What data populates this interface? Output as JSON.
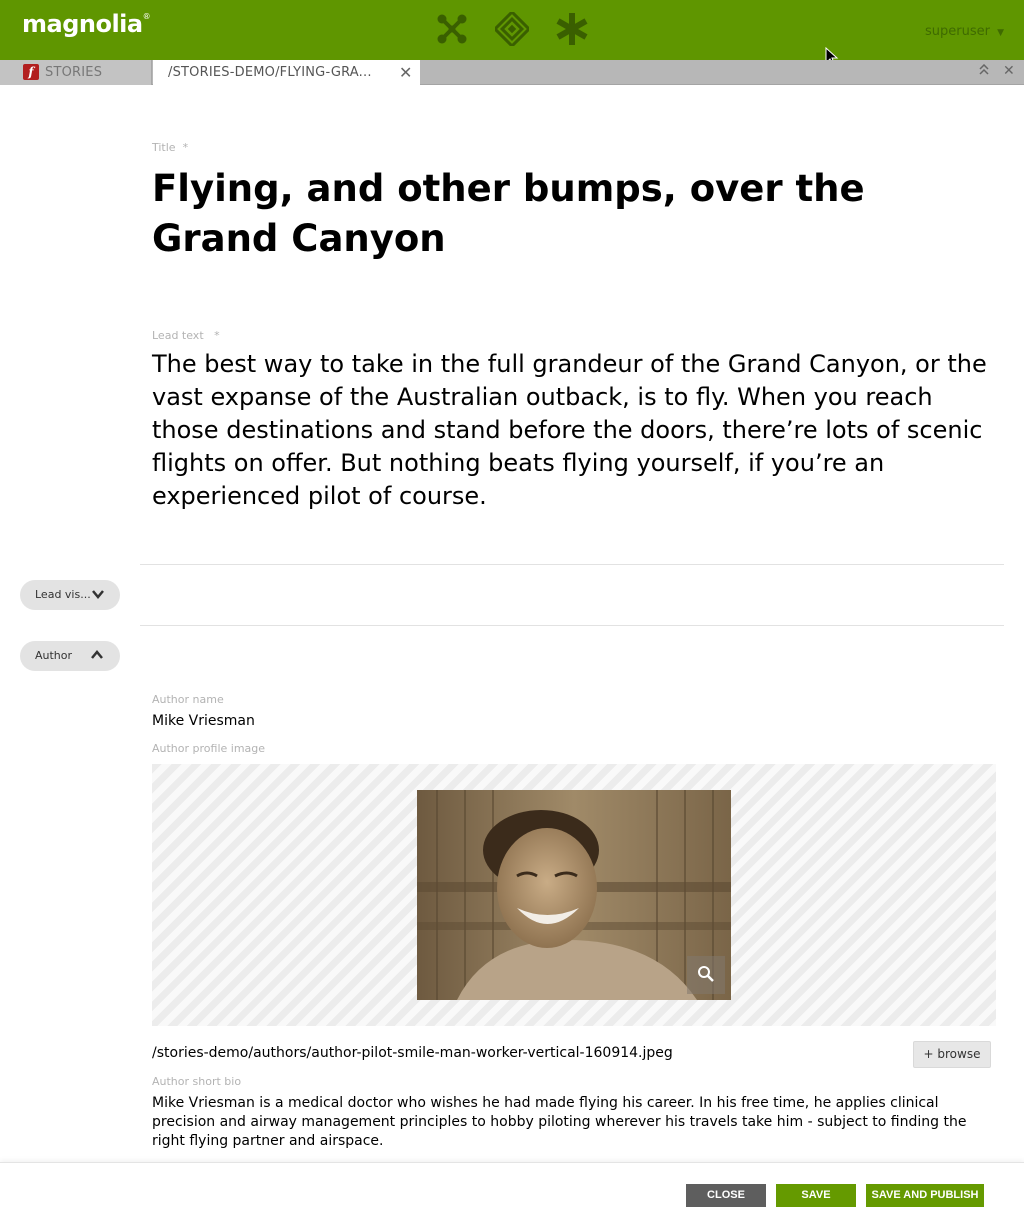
{
  "header": {
    "logo_text": "magnolia",
    "logo_mark": "®",
    "app_icons": [
      "apps-launcher-icon",
      "pulse-diamond-icon",
      "favorites-asterisk-icon"
    ],
    "user": "superuser",
    "colors": {
      "bar": "#5f9600",
      "icons": "#3a5f00"
    }
  },
  "tabs": {
    "app_tab": {
      "label": "STORIES",
      "badge": "f"
    },
    "active_tab": {
      "label": "/STORIES-DEMO/FLYING-GRA..."
    }
  },
  "form": {
    "title": {
      "label": "Title",
      "required": "*",
      "value": "Flying, and other bumps, over the Grand Canyon"
    },
    "lead_text": {
      "label": "Lead text",
      "required": "*",
      "value": "The best way to take in the full grandeur of the Grand Canyon, or the vast expanse of the Australian outback, is to fly. When you reach those destinations and stand before the doors, there’re lots of scenic flights on offer. But nothing beats flying yourself, if you’re an experienced pilot of course."
    },
    "sections": {
      "lead_visual": {
        "label": "Lead vis...",
        "state": "collapsed"
      },
      "author": {
        "label": "Author",
        "state": "expanded"
      }
    },
    "author_name": {
      "label": "Author name",
      "value": "Mike Vriesman"
    },
    "author_image": {
      "label": "Author profile image",
      "path": "/stories-demo/authors/author-pilot-smile-man-worker-vertical-160914.jpeg",
      "browse_label": "+ browse"
    },
    "author_bio": {
      "label": "Author short bio",
      "value": "Mike Vriesman is a medical doctor who wishes he had made flying his career. In his free time, he applies clinical precision and airway management principles to hobby piloting wherever his travels take him - subject to finding the right flying partner and airspace."
    }
  },
  "footer": {
    "close_label": "CLOSE",
    "save_label": "SAVE",
    "publish_label": "SAVE AND PUBLISH"
  }
}
